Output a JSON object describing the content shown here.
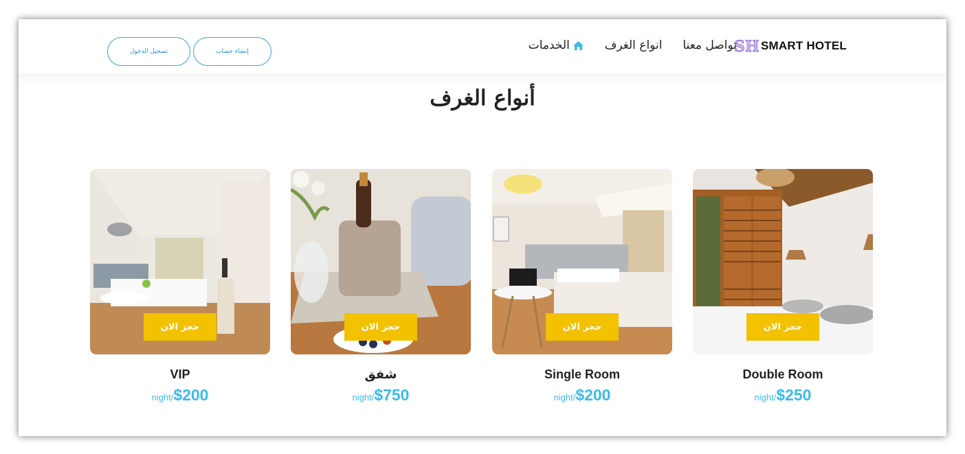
{
  "nav": {
    "logo_mark": "SH",
    "logo_text": "SMART HOTEL",
    "links": [
      {
        "label": "الخدمات",
        "icon": "home-icon"
      },
      {
        "label": "انواع الغرف"
      },
      {
        "label": "تواصل معنا"
      }
    ],
    "register_label": "إنشاء حساب",
    "login_label": "تسجيل الدخول"
  },
  "main": {
    "title": "أنواع الغرف",
    "rooms": [
      {
        "name": "Double Room",
        "price": "$250",
        "unit": "night/",
        "button": "حجز الان"
      },
      {
        "name": "Single Room",
        "price": "$200",
        "unit": "night/",
        "button": "حجز الان"
      },
      {
        "name": "شفق",
        "price": "$750",
        "unit": "night/",
        "button": "حجز الان"
      },
      {
        "name": "VIP",
        "price": "$200",
        "unit": "night/",
        "button": "حجز الان"
      }
    ]
  },
  "colors": {
    "accent": "#3db9ec",
    "button": "#f2c100",
    "outline": "#3aa0e6"
  }
}
